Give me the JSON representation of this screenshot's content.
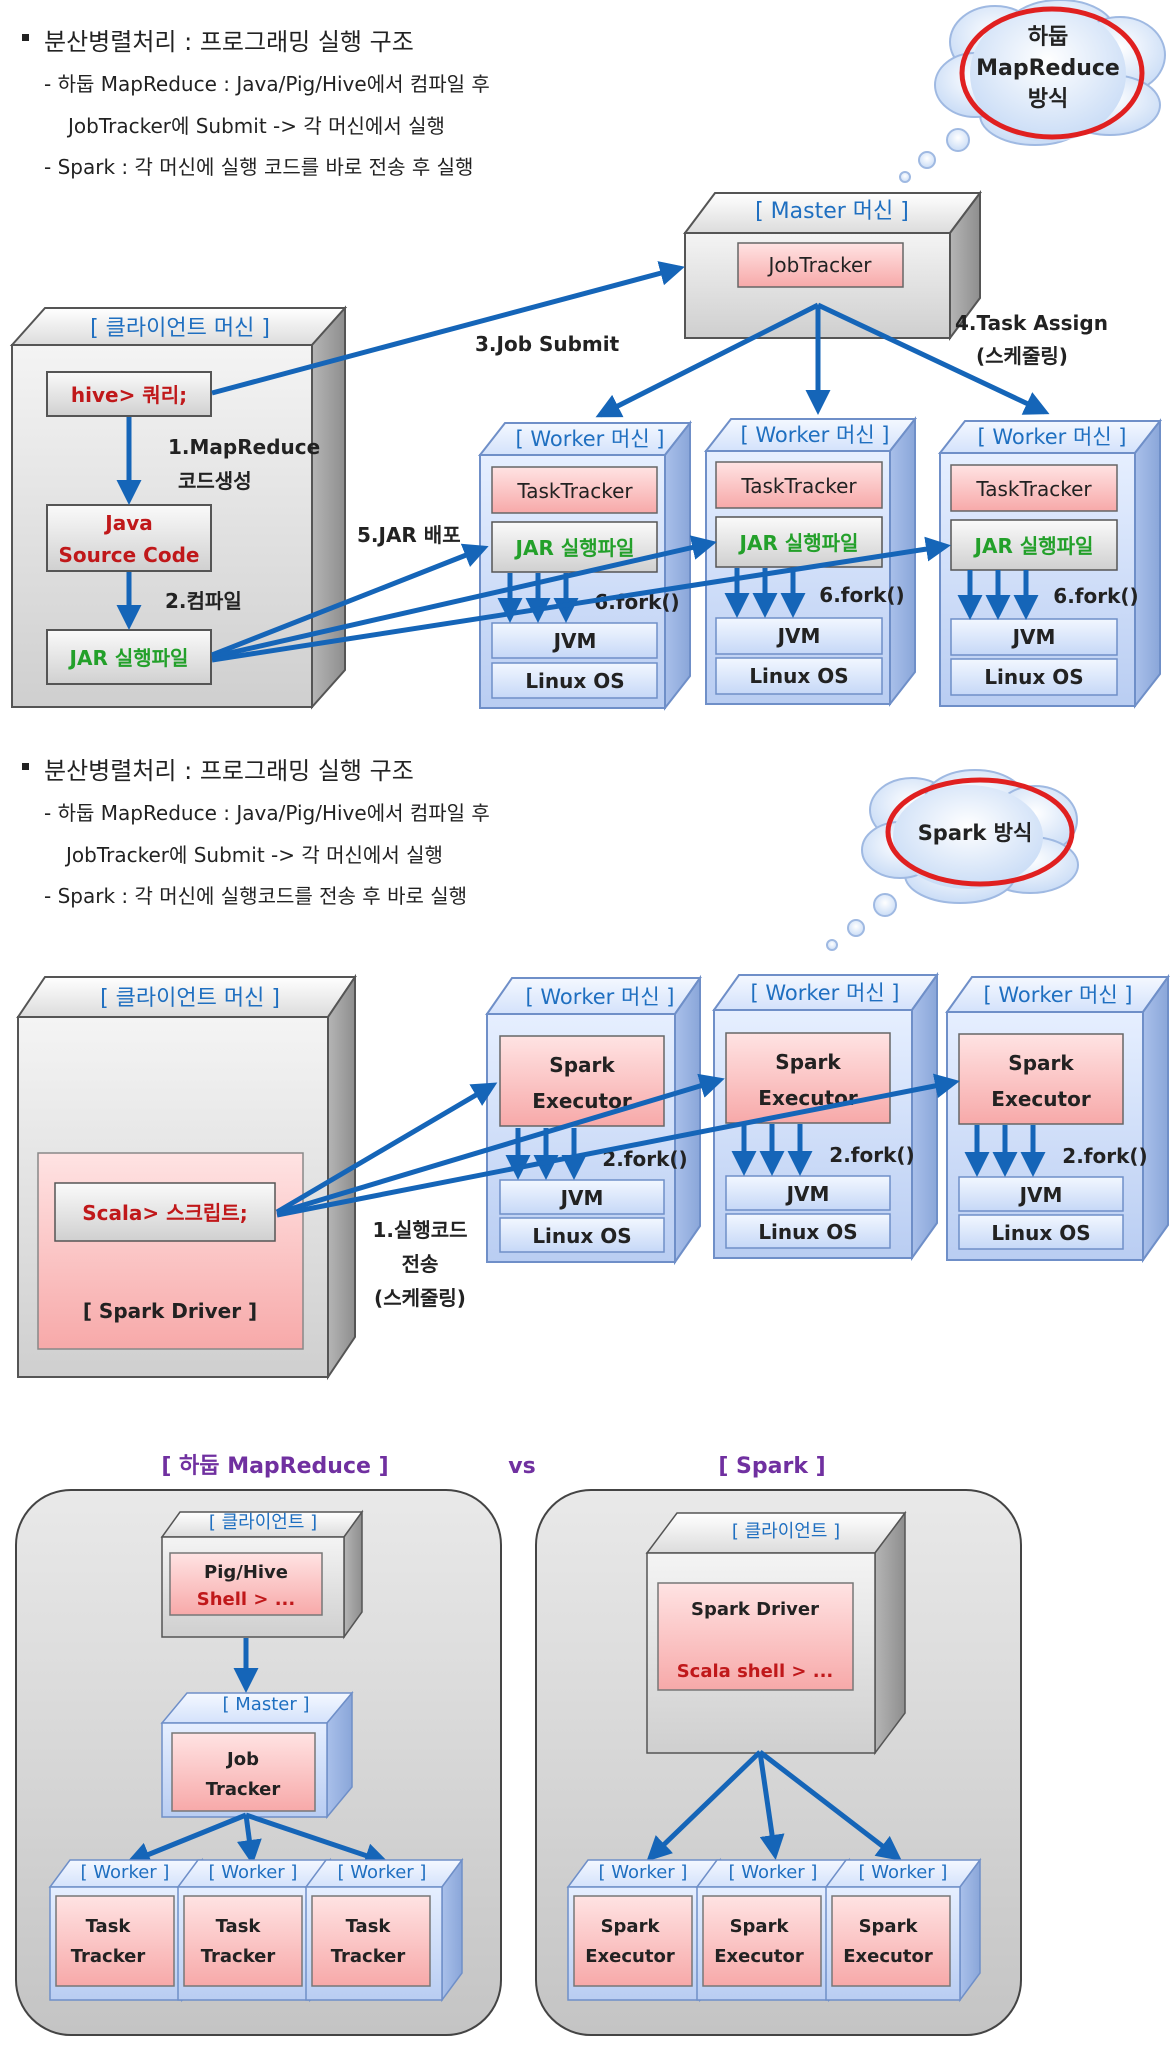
{
  "section1": {
    "heading": "분산병렬처리 : 프로그래밍 실행 구조",
    "line1": "- 하둡 MapReduce : Java/Pig/Hive에서 컴파일 후",
    "line2": "JobTracker에 Submit -> 각 머신에서 실행",
    "line3": "- Spark : 각 머신에 실행 코드를 바로 전송 후 실행",
    "cloud": [
      "하둡",
      "MapReduce",
      "방식"
    ],
    "client_title": "[ 클라이언트 머신 ]",
    "hive_box": "hive> 쿼리;",
    "java_box": [
      "Java",
      "Source Code"
    ],
    "jar_box": "JAR 실행파일",
    "master_title": "[ Master 머신 ]",
    "jobtracker": "JobTracker",
    "worker_title": "[ Worker 머신 ]",
    "tasktracker": "TaskTracker",
    "worker_jar": "JAR 실행파일",
    "jvm": "JVM",
    "linux": "Linux OS",
    "fork": "6.fork()",
    "step1": [
      "1.MapReduce",
      "코드생성"
    ],
    "step2": "2.컴파일",
    "step3": "3.Job Submit",
    "step4": [
      "4.Task Assign",
      "(스케줄링)"
    ],
    "step5": "5.JAR 배포"
  },
  "section2": {
    "heading": "분산병렬처리 : 프로그래밍 실행 구조",
    "line1": "- 하둡 MapReduce : Java/Pig/Hive에서 컴파일 후",
    "line2": "JobTracker에 Submit -> 각 머신에서 실행",
    "line3": "- Spark : 각 머신에 실행코드를 전송 후 바로 실행",
    "cloud": "Spark 방식",
    "client_title": "[ 클라이언트 머신 ]",
    "scala_box": "Scala> 스크립트;",
    "driver": "[ Spark Driver ]",
    "worker_title": "[ Worker 머신 ]",
    "executor": [
      "Spark",
      "Executor"
    ],
    "jvm": "JVM",
    "linux": "Linux OS",
    "fork": "2.fork()",
    "step1": [
      "1.실행코드",
      "전송",
      "(스케줄링)"
    ]
  },
  "section3": {
    "left_title": "[ 하둡 MapReduce ]",
    "vs": "vs",
    "right_title": "[ Spark ]",
    "client": "[ 클라이언트 ]",
    "pig_hive": "Pig/Hive",
    "shell": "Shell > ...",
    "master": "[ Master ]",
    "job_tracker": [
      "Job",
      "Tracker"
    ],
    "worker": "[ Worker ]",
    "task_tracker": [
      "Task",
      "Tracker"
    ],
    "spark_driver": "Spark Driver",
    "scala_shell": "Scala shell > ...",
    "spark_executor": [
      "Spark",
      "Executor"
    ]
  },
  "colors": {
    "blue_text": "#1f6fc0",
    "arrow": "#1565b8",
    "red_text": "#c0181a",
    "green_text": "#23a02a",
    "purple_text": "#7030a0",
    "cloud_ring": "#e02020"
  }
}
